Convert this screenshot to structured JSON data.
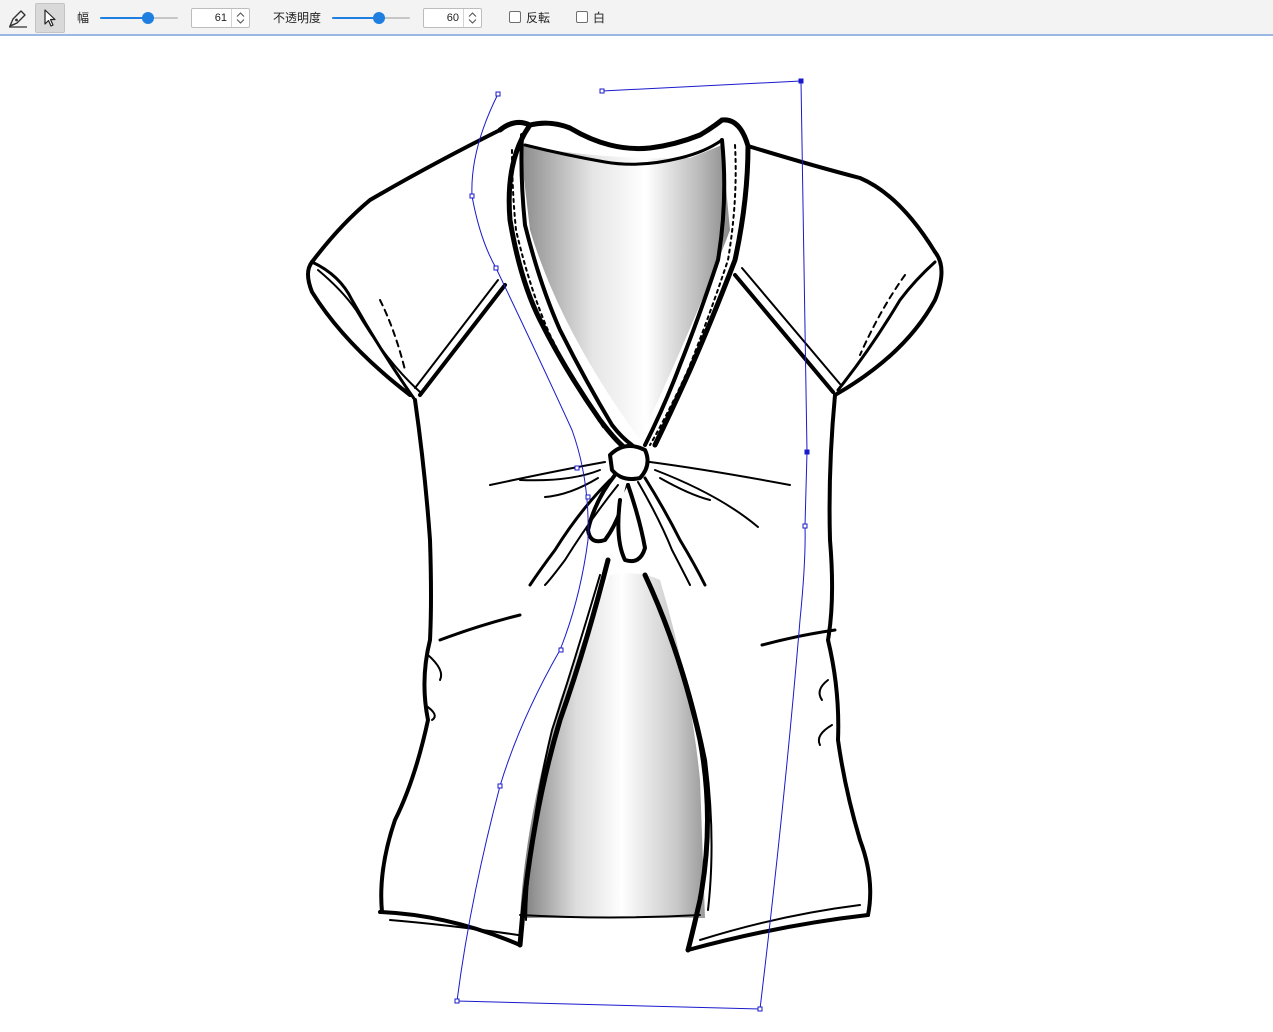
{
  "toolbar": {
    "tools": [
      {
        "name": "pen-tool",
        "active": false
      },
      {
        "name": "select-tool",
        "active": true
      }
    ],
    "width_label": "幅",
    "width_value": "61",
    "width_level": 0.61,
    "opacity_label": "不透明度",
    "opacity_value": "60",
    "opacity_level": 0.6,
    "invert_label": "反転",
    "invert_checked": false,
    "white_label": "白",
    "white_checked": false
  },
  "colors": {
    "accent": "#1e7fe0",
    "path": "#1a1acc",
    "toolbar_border": "#9ab7e6"
  }
}
